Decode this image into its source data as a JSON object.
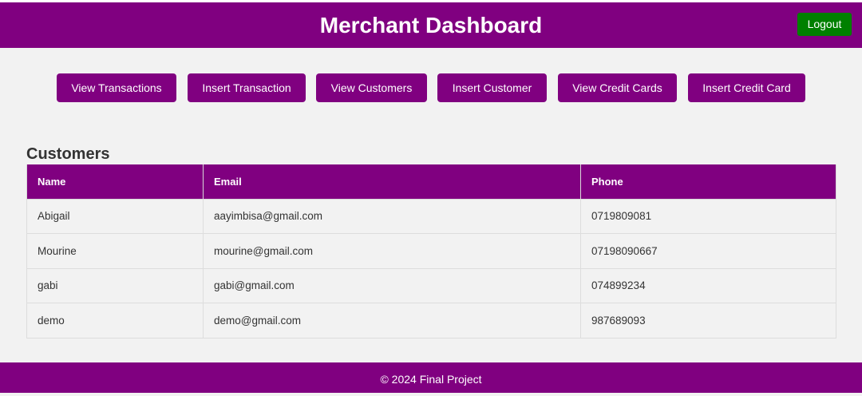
{
  "header": {
    "title": "Merchant Dashboard",
    "logout_label": "Logout"
  },
  "nav": {
    "buttons": [
      {
        "label": "View Transactions"
      },
      {
        "label": "Insert Transaction"
      },
      {
        "label": "View Customers"
      },
      {
        "label": "Insert Customer"
      },
      {
        "label": "View Credit Cards"
      },
      {
        "label": "Insert Credit Card"
      }
    ]
  },
  "customers": {
    "title": "Customers",
    "columns": [
      "Name",
      "Email",
      "Phone"
    ],
    "rows": [
      {
        "name": "Abigail",
        "email": "aayimbisa@gmail.com",
        "phone": "0719809081"
      },
      {
        "name": "Mourine",
        "email": "mourine@gmail.com",
        "phone": "07198090667"
      },
      {
        "name": "gabi",
        "email": "gabi@gmail.com",
        "phone": "074899234"
      },
      {
        "name": "demo",
        "email": "demo@gmail.com",
        "phone": "987689093"
      }
    ]
  },
  "footer": {
    "text": "© 2024 Final Project"
  },
  "colors": {
    "brand": "#800080",
    "logout": "#008000",
    "background": "#f2f2f2"
  }
}
